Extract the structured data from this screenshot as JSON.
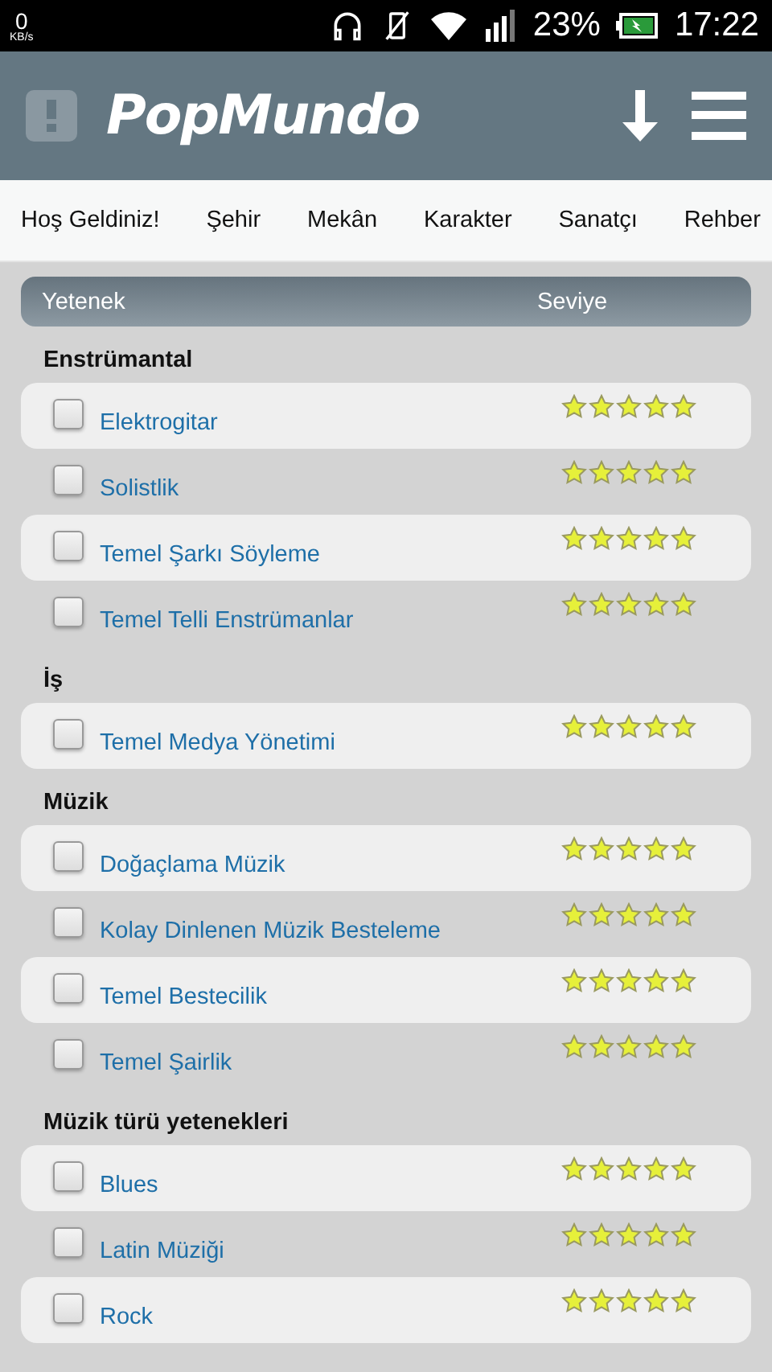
{
  "status_bar": {
    "speed": "0",
    "speed_unit": "KB/s",
    "battery": "23%",
    "time": "17:22"
  },
  "header": {
    "logo": "PopMundo"
  },
  "nav": [
    {
      "label": "Hoş Geldiniz!"
    },
    {
      "label": "Şehir"
    },
    {
      "label": "Mekân"
    },
    {
      "label": "Karakter"
    },
    {
      "label": "Sanatçı"
    },
    {
      "label": "Rehber"
    }
  ],
  "table": {
    "columns": [
      "Yetenek",
      "Seviye"
    ],
    "groups": [
      {
        "title": "Enstrümantal",
        "rows": [
          {
            "name": "Elektrogitar",
            "checked": false,
            "stars": 5
          },
          {
            "name": "Solistlik",
            "checked": false,
            "stars": 5
          },
          {
            "name": "Temel Şarkı Söyleme",
            "checked": false,
            "stars": 5
          },
          {
            "name": "Temel Telli Enstrümanlar",
            "checked": false,
            "stars": 5
          }
        ]
      },
      {
        "title": "İş",
        "rows": [
          {
            "name": "Temel Medya Yönetimi",
            "checked": false,
            "stars": 5
          }
        ]
      },
      {
        "title": "Müzik",
        "rows": [
          {
            "name": "Doğaçlama Müzik",
            "checked": false,
            "stars": 5
          },
          {
            "name": "Kolay Dinlenen Müzik Besteleme",
            "checked": false,
            "stars": 5
          },
          {
            "name": "Temel Bestecilik",
            "checked": false,
            "stars": 5
          },
          {
            "name": "Temel Şairlik",
            "checked": false,
            "stars": 5
          }
        ]
      },
      {
        "title": "Müzik türü yetenekleri",
        "rows": [
          {
            "name": "Blues",
            "checked": false,
            "stars": 5
          },
          {
            "name": "Latin Müziği",
            "checked": false,
            "stars": 5
          },
          {
            "name": "Rock",
            "checked": false,
            "stars": 5
          }
        ]
      }
    ]
  }
}
